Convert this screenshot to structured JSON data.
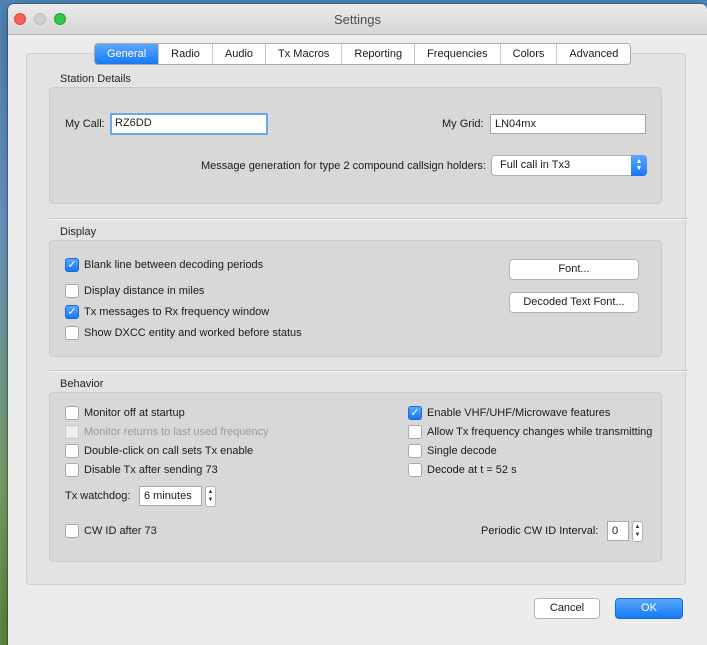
{
  "window": {
    "title": "Settings"
  },
  "tabs": [
    {
      "label": "General",
      "active": true
    },
    {
      "label": "Radio"
    },
    {
      "label": "Audio"
    },
    {
      "label": "Tx Macros"
    },
    {
      "label": "Reporting"
    },
    {
      "label": "Frequencies"
    },
    {
      "label": "Colors"
    },
    {
      "label": "Advanced"
    }
  ],
  "station": {
    "group_label": "Station Details",
    "my_call_label": "My Call:",
    "my_call_value": "RZ6DD",
    "my_grid_label": "My Grid:",
    "my_grid_value": "LN04mx",
    "msg_gen_label": "Message generation for type 2 compound callsign holders:",
    "msg_gen_value": "Full call in Tx3"
  },
  "display": {
    "group_label": "Display",
    "blank_line": {
      "label": "Blank line between decoding periods",
      "checked": true
    },
    "distance_miles": {
      "label": "Display distance in miles",
      "checked": false
    },
    "tx_messages": {
      "label": "Tx messages to Rx frequency window",
      "checked": true
    },
    "show_dxcc": {
      "label": "Show DXCC entity and worked before status",
      "checked": false
    },
    "font_button": "Font...",
    "decoded_font_button": "Decoded Text Font..."
  },
  "behavior": {
    "group_label": "Behavior",
    "monitor_off": {
      "label": "Monitor off at startup",
      "checked": false
    },
    "monitor_returns": {
      "label": "Monitor returns to last used frequency",
      "checked": false,
      "disabled": true
    },
    "double_click": {
      "label": "Double-click on call sets Tx enable",
      "checked": false
    },
    "disable_tx": {
      "label": "Disable Tx after sending 73",
      "checked": false
    },
    "enable_vhf": {
      "label": "Enable VHF/UHF/Microwave features",
      "checked": true
    },
    "allow_tx_freq": {
      "label": "Allow Tx frequency changes while transmitting",
      "checked": false
    },
    "single_decode": {
      "label": "Single decode",
      "checked": false
    },
    "decode_at": {
      "label": "Decode at t = 52 s",
      "checked": false
    },
    "watchdog_label": "Tx watchdog:",
    "watchdog_value": "6 minutes",
    "cw_id": {
      "label": "CW ID after 73",
      "checked": false
    },
    "periodic_label": "Periodic CW ID Interval:",
    "periodic_value": "0"
  },
  "footer": {
    "cancel": "Cancel",
    "ok": "OK"
  },
  "icons": {
    "check": "checkmark-icon",
    "stepper": "up-down-arrows-icon",
    "dropdown": "chevron-up-down-icon"
  }
}
